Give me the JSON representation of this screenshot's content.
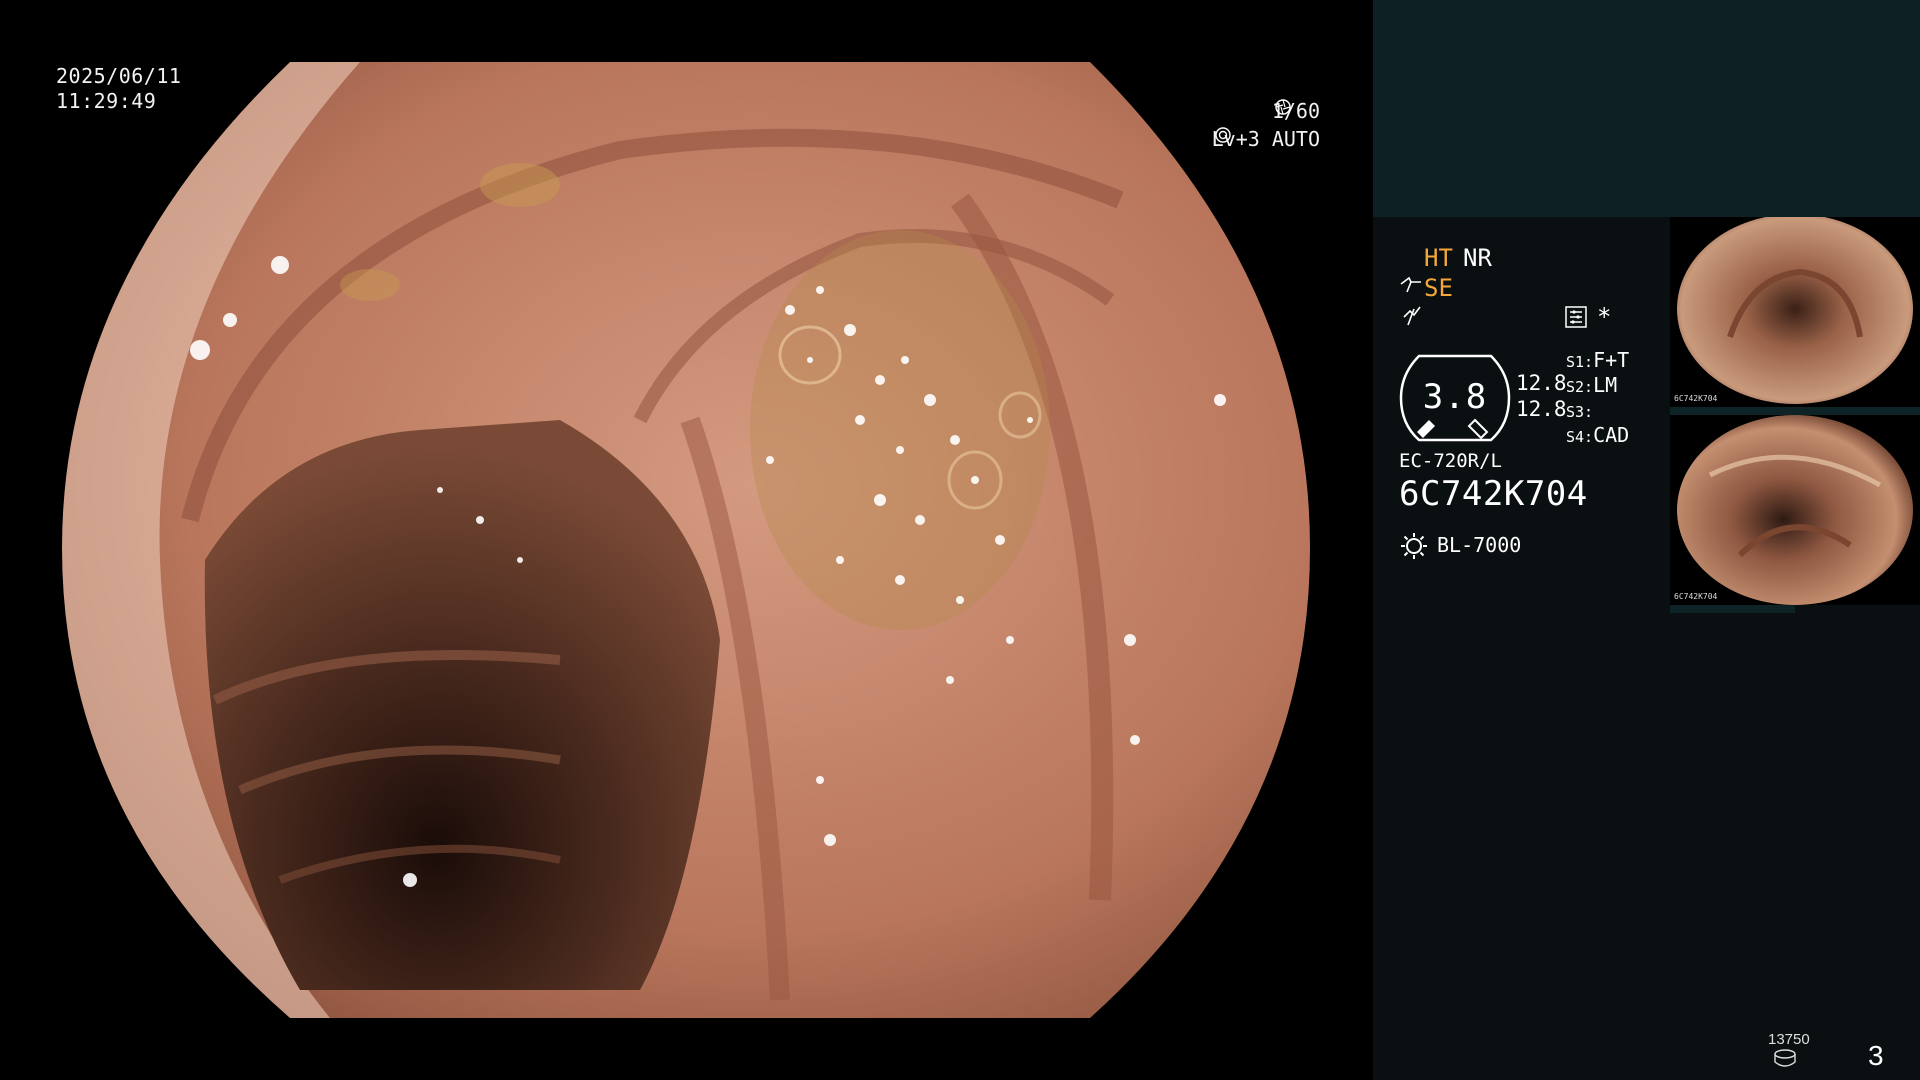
{
  "overlay": {
    "date": "2025/06/11",
    "time": "11:29:49",
    "shutter": "1/60",
    "level": "Lv+3 AUTO"
  },
  "panel": {
    "ht": "HT",
    "nr": "NR",
    "se": "SE",
    "star": "*",
    "gauge_value": "3.8",
    "value1": "12.8",
    "value2": "12.8",
    "settings": [
      {
        "key": "S1:",
        "value": "F+T"
      },
      {
        "key": "S2:",
        "value": "LM"
      },
      {
        "key": "S3:",
        "value": ""
      },
      {
        "key": "S4:",
        "value": "CAD"
      }
    ],
    "scope_model": "EC-720R/L",
    "serial": "6C742K704",
    "light_source": "BL-7000",
    "thumb_label": "6C742K704",
    "counter": "13750",
    "page_number": "3"
  },
  "colors": {
    "accent_orange": "#f5a73b",
    "panel_bg": "#0a1012",
    "panel_top_bg": "#0d2024",
    "tissue": "#c0826a"
  },
  "icons": [
    "aperture-icon",
    "iris-icon",
    "scope-se-icon",
    "zap-icon",
    "menu-list-icon",
    "light-source-icon",
    "disk-icon"
  ]
}
